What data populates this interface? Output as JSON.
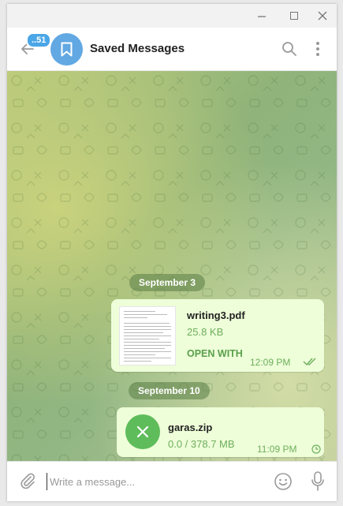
{
  "header": {
    "unread_count": "..51",
    "title": "Saved Messages"
  },
  "chat": {
    "messages": [
      {
        "date": "September 3",
        "file_name": "writing3.pdf",
        "file_size": "25.8 KB",
        "action": "OPEN WITH",
        "time": "12:09 PM",
        "status": "read"
      },
      {
        "date": "September 10",
        "file_name": "garas.zip",
        "file_size": "0.0 / 378.7 MB",
        "time": "11:09 PM",
        "status": "pending"
      }
    ]
  },
  "composer": {
    "placeholder": "Write a message..."
  },
  "icons": {
    "back": "arrow-left-icon",
    "avatar": "bookmark-icon",
    "search": "search-icon",
    "more": "more-vertical-icon",
    "attach": "paperclip-icon",
    "emoji": "emoji-icon",
    "mic": "microphone-icon",
    "cancel": "close-icon",
    "read_status": "double-check-icon",
    "pending_status": "clock-icon"
  },
  "colors": {
    "accent": "#62a8e3",
    "bubble": "#eefed9",
    "bubble_text_accent": "#5aa04b",
    "zip_icon": "#5fbc5b"
  }
}
